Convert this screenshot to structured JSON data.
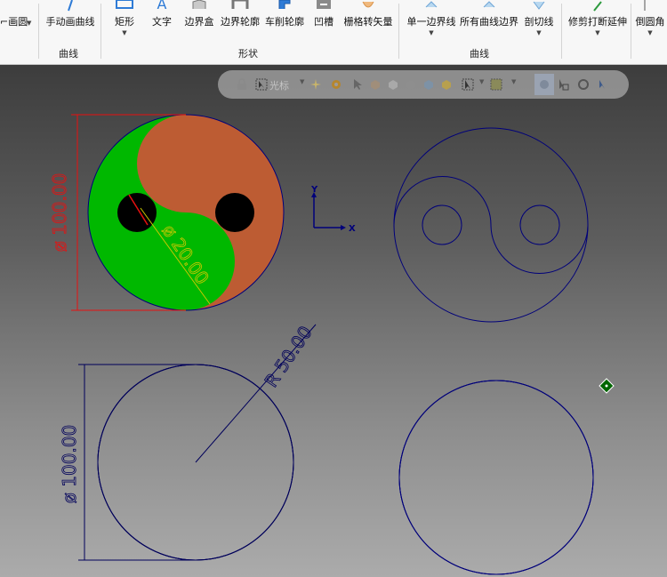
{
  "ribbon": {
    "tools": [
      {
        "id": "arc-circle",
        "label": "⌐画圆",
        "has_menu": true
      },
      {
        "id": "freehand-curve",
        "label": "手动画曲线",
        "has_menu": false
      },
      {
        "id": "rectangle",
        "label": "矩形",
        "has_menu": true
      },
      {
        "id": "text",
        "label": "文字",
        "has_menu": false
      },
      {
        "id": "bounding-box",
        "label": "边界盒",
        "has_menu": false
      },
      {
        "id": "boundary-profile",
        "label": "边界轮廓",
        "has_menu": false
      },
      {
        "id": "lathe-profile",
        "label": "车削轮廓",
        "has_menu": false
      },
      {
        "id": "groove",
        "label": "凹槽",
        "has_menu": false
      },
      {
        "id": "raster-to-vector",
        "label": "栅格转矢量",
        "has_menu": false
      },
      {
        "id": "single-boundary",
        "label": "单一边界线",
        "has_menu": true
      },
      {
        "id": "all-curve-boundary",
        "label": "所有曲线边界",
        "has_menu": false
      },
      {
        "id": "section-line",
        "label": "剖切线",
        "has_menu": true
      },
      {
        "id": "trim-break-extend",
        "label": "修剪打断延伸",
        "has_menu": true
      },
      {
        "id": "fillet",
        "label": "倒圆角",
        "has_menu": true
      }
    ],
    "groups": [
      {
        "id": "curves-1",
        "label": "曲线"
      },
      {
        "id": "shapes",
        "label": "形状"
      },
      {
        "id": "curves-2",
        "label": "曲线"
      }
    ]
  },
  "selection_toolbar": {
    "snap_mode": "光标",
    "icons": [
      "lock-icon",
      "cursor-snap-icon",
      "snap-options-icon",
      "gear-icon",
      "select-arrow-icon",
      "solid-select-icon",
      "face-select-icon",
      "body-select-icon",
      "cube-icon",
      "box-select-icon",
      "window-select-icon",
      "quick-mask-icon",
      "rotate-icon",
      "undo-select-icon"
    ]
  },
  "drawing": {
    "axis": {
      "x_label": "X",
      "y_label": "Y"
    },
    "dimensions": {
      "yinyang_diameter": "ø 100.00",
      "yinyang_hole_diameter": "ø 20.00",
      "flower_diameter": "ø 100.00",
      "flower_radius": "R 50.00"
    },
    "colors": {
      "yin_fill": "#bd5c33",
      "yang_fill": "#00b800",
      "outline": "#00007a",
      "dimension_red": "#e81010",
      "dimension_yellow": "#c8c800",
      "dimension_blue": "#00005a",
      "marker_green": "#006400"
    }
  }
}
